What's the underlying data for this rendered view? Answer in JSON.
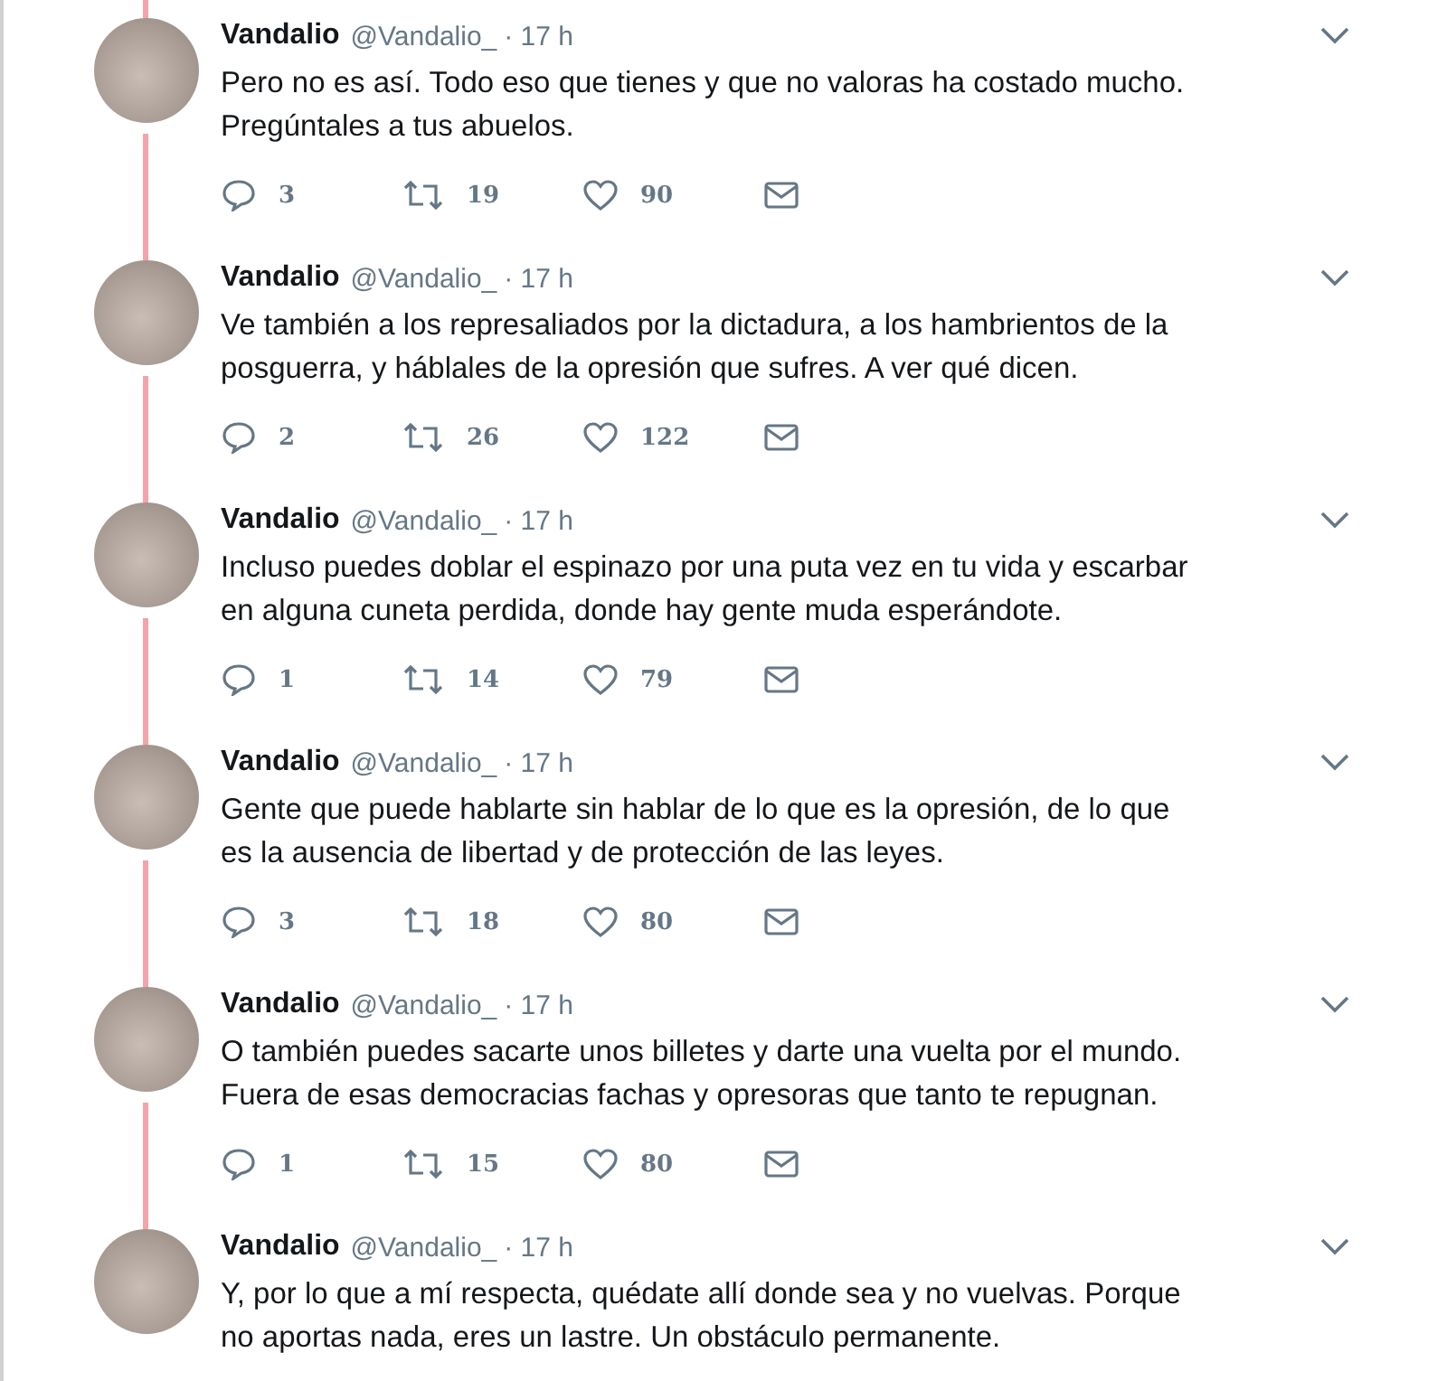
{
  "tweets": [
    {
      "name": "Vandalio",
      "handle": "@Vandalio_",
      "time": "· 17 h",
      "text": "Pero no es así. Todo eso que tienes y que no valoras ha costado mucho. Pregúntales a tus abuelos.",
      "replies": "3",
      "retweets": "19",
      "likes": "90"
    },
    {
      "name": "Vandalio",
      "handle": "@Vandalio_",
      "time": "· 17 h",
      "text": "Ve también a los represaliados por la dictadura, a los hambrientos de la posguerra, y háblales de la opresión que sufres. A ver qué dicen.",
      "replies": "2",
      "retweets": "26",
      "likes": "122"
    },
    {
      "name": "Vandalio",
      "handle": "@Vandalio_",
      "time": "· 17 h",
      "text": "Incluso puedes doblar el espinazo por una puta vez en tu vida y escarbar en alguna cuneta perdida, donde hay gente muda esperándote.",
      "replies": "1",
      "retweets": "14",
      "likes": "79"
    },
    {
      "name": "Vandalio",
      "handle": "@Vandalio_",
      "time": "· 17 h",
      "text": "Gente que puede hablarte sin hablar de lo que es la opresión, de lo que es la ausencia de libertad y de protección de las leyes.",
      "replies": "3",
      "retweets": "18",
      "likes": "80"
    },
    {
      "name": "Vandalio",
      "handle": "@Vandalio_",
      "time": "· 17 h",
      "text": "O también puedes sacarte unos billetes y darte una vuelta por el mundo. Fuera de esas democracias fachas y opresoras que tanto te repugnan.",
      "replies": "1",
      "retweets": "15",
      "likes": "80"
    },
    {
      "name": "Vandalio",
      "handle": "@Vandalio_",
      "time": "· 17 h",
      "text": "Y, por lo que a mí respecta, quédate allí donde sea y no vuelvas. Porque no aportas nada, eres un lastre. Un obstáculo permanente."
    }
  ]
}
